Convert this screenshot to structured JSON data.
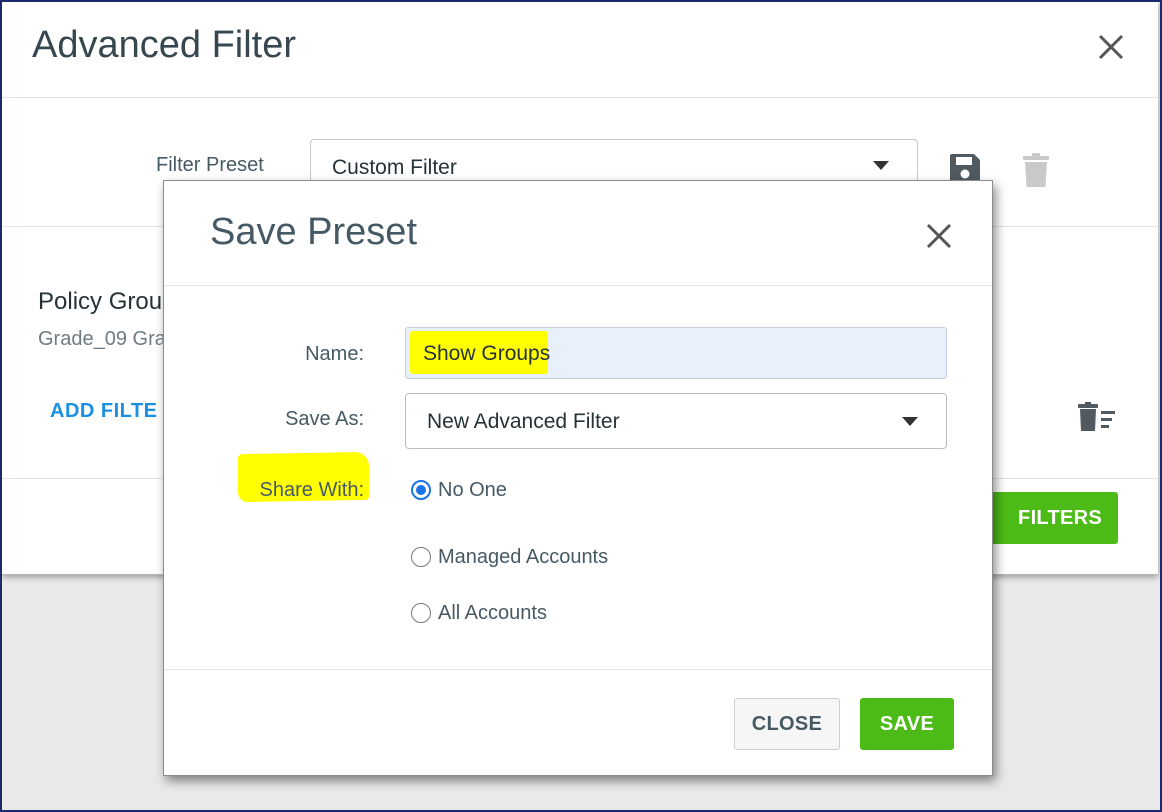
{
  "advanced_filter": {
    "title": "Advanced Filter",
    "filter_preset_label": "Filter Preset",
    "filter_preset_value": "Custom Filter",
    "policy_group_title": "Policy Grou",
    "policy_group_subtitle": "Grade_09 Gra",
    "add_filter_label": "ADD FILTE",
    "apply_button_label": "FILTERS"
  },
  "save_preset": {
    "title": "Save Preset",
    "name_label": "Name:",
    "name_value": "Show Groups",
    "save_as_label": "Save As:",
    "save_as_value": "New Advanced Filter",
    "share_with_label": "Share With:",
    "share_options": [
      {
        "label": "No One",
        "checked": true
      },
      {
        "label": "Managed Accounts",
        "checked": false
      },
      {
        "label": "All Accounts",
        "checked": false
      }
    ],
    "close_button": "CLOSE",
    "save_button": "SAVE"
  },
  "colors": {
    "accent_green": "#4cbb17",
    "link_blue": "#1a8fe3",
    "highlight_yellow": "#ffff00",
    "radio_blue": "#1a73e8"
  },
  "icons": {
    "dialog_close": "close-icon",
    "save_preset": "floppy-disk-icon",
    "delete_preset": "trash-icon",
    "clear_filters": "trash-list-icon",
    "dropdown": "caret-down-icon"
  }
}
